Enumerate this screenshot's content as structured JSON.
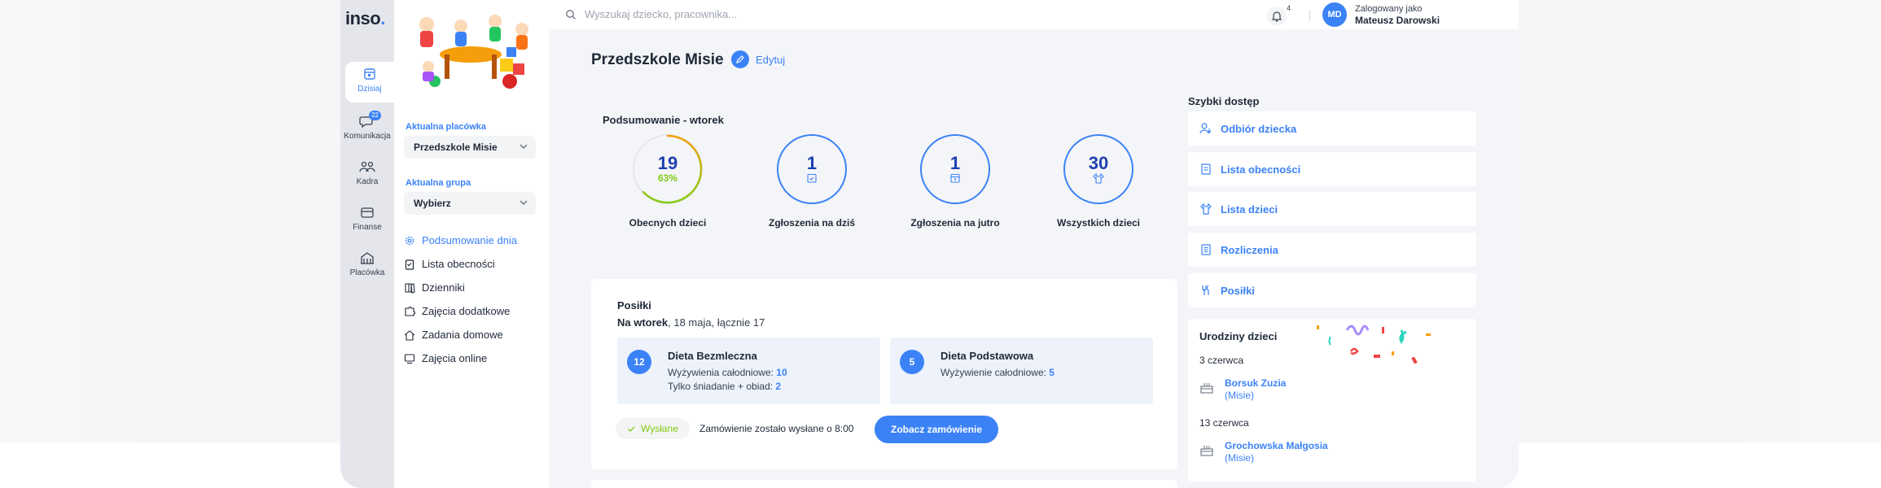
{
  "app": {
    "logo_main": "inso",
    "logo_dot": "."
  },
  "rail": {
    "items": [
      {
        "label": "Dzisiaj",
        "icon": "calendar-icon"
      },
      {
        "label": "Komunikacja",
        "icon": "chat-icon",
        "badge": "22"
      },
      {
        "label": "Kadra",
        "icon": "people-icon"
      },
      {
        "label": "Finanse",
        "icon": "wallet-icon"
      },
      {
        "label": "Placówka",
        "icon": "building-icon"
      }
    ]
  },
  "panel": {
    "facility_label": "Aktualna placówka",
    "facility_value": "Przedszkole Misie",
    "group_label": "Aktualna grupa",
    "group_value": "Wybierz",
    "menu": [
      {
        "label": "Podsumowanie dnia",
        "icon": "gear-icon"
      },
      {
        "label": "Lista obecności",
        "icon": "clipboard-icon"
      },
      {
        "label": "Dzienniki",
        "icon": "book-icon"
      },
      {
        "label": "Zajęcia dodatkowe",
        "icon": "puzzle-icon"
      },
      {
        "label": "Zadania domowe",
        "icon": "home-task-icon"
      },
      {
        "label": "Zajęcia online",
        "icon": "monitor-icon"
      }
    ]
  },
  "topbar": {
    "search_placeholder": "Wyszukaj dziecko, pracownika...",
    "notifications": "4",
    "avatar": "MD",
    "logged_as": "Zalogowany jako",
    "user_name": "Mateusz Darowski"
  },
  "main": {
    "title": "Przedszkole Misie",
    "edit_label": "Edytuj",
    "summary_title": "Podsumowanie - wtorek",
    "stats": [
      {
        "value": "19",
        "sub": "63%",
        "label": "Obecnych dzieci",
        "fraction": 0.63
      },
      {
        "value": "1",
        "label": "Zgłoszenia na dziś",
        "icon": "calendar-check-icon"
      },
      {
        "value": "1",
        "label": "Zgłoszenia na jutro",
        "icon": "calendar-icon"
      },
      {
        "value": "30",
        "label": "Wszystkich dzieci",
        "icon": "shirt-icon"
      }
    ]
  },
  "meals": {
    "title": "Posiłki",
    "sub_bold": "Na wtorek",
    "sub_rest": ", 18 maja, łącznie 17",
    "diets": [
      {
        "count": "12",
        "name": "Dieta Bezmleczna",
        "lines": [
          {
            "text": "Wyżywienia całodniowe: ",
            "value": "10"
          },
          {
            "text": "Tylko śniadanie + obiad: ",
            "value": "2"
          }
        ]
      },
      {
        "count": "5",
        "name": "Dieta Podstawowa",
        "lines": [
          {
            "text": "Wyżywienie całodniowe: ",
            "value": "5"
          }
        ]
      }
    ],
    "status": "Wysłane",
    "status_text": "Zamówienie zostało wysłane o 8:00",
    "order_button": "Zobacz zamówienie"
  },
  "quick_access": {
    "title": "Szybki dostęp",
    "items": [
      {
        "label": "Odbiór dziecka",
        "icon": "pickup-icon"
      },
      {
        "label": "Lista obecności",
        "icon": "clipboard-icon"
      },
      {
        "label": "Lista dzieci",
        "icon": "shirt-icon"
      },
      {
        "label": "Rozliczenia",
        "icon": "document-icon"
      },
      {
        "label": "Posiłki",
        "icon": "cutlery-icon"
      }
    ]
  },
  "birthdays": {
    "title": "Urodziny dzieci",
    "entries": [
      {
        "date": "3 czerwca",
        "name": "Borsuk Zuzia",
        "group": "(Misie)"
      },
      {
        "date": "13 czerwca",
        "name": "Grochowska Małgosia",
        "group": "(Misie)"
      }
    ]
  },
  "colors": {
    "accent": "#3b82f6",
    "success": "#84cc16",
    "background": "#f4f5f8"
  }
}
